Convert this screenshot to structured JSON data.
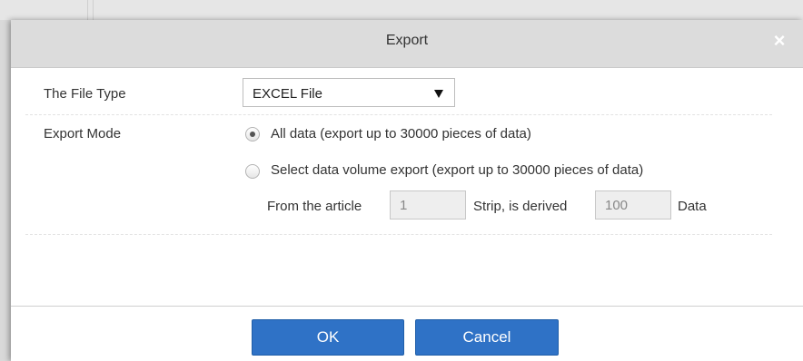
{
  "dialog": {
    "title": "Export",
    "close_glyph": "×"
  },
  "file_type": {
    "label": "The File Type",
    "selected": "EXCEL File"
  },
  "export_mode": {
    "label": "Export Mode",
    "options": [
      {
        "label": "All data (export up to 30000 pieces of data)",
        "checked": true
      },
      {
        "label": "Select data volume export (export up to 30000 pieces of data)",
        "checked": false
      }
    ],
    "range": {
      "from_label": "From the article",
      "from_value": "1",
      "strip_label": "Strip, is derived",
      "count_value": "100",
      "data_label": "Data"
    }
  },
  "buttons": {
    "ok": "OK",
    "cancel": "Cancel"
  },
  "colors": {
    "header_bg": "#dcdcdc",
    "button_bg": "#2f72c6"
  },
  "icons": {
    "close": "close-icon",
    "dropdown": "chevron-down-icon"
  }
}
